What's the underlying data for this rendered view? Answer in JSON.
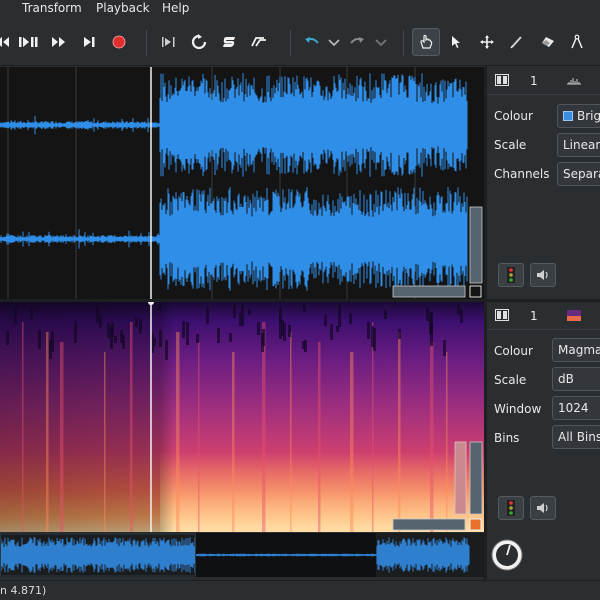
{
  "menu": {
    "transform": "Transform",
    "playback": "Playback",
    "help": "Help"
  },
  "toolbar": {
    "icons": [
      "rewind-icon",
      "play-pause-icon",
      "fast-forward-icon",
      "skip-end-icon",
      "record-icon",
      "play-selection-icon",
      "loop-icon",
      "solo-icon",
      "follow-playback-icon",
      "undo-icon",
      "redo-icon",
      "navigate-icon",
      "select-icon",
      "move-icon",
      "draw-icon",
      "erase-icon",
      "measure-icon"
    ],
    "active_tool": "navigate"
  },
  "waveform_pane": {
    "layer_number": "1",
    "colour_label": "Colour",
    "colour_value": "Brig",
    "colour_swatch": "#3a8de0",
    "scale_label": "Scale",
    "scale_value": "Linear",
    "channels_label": "Channels",
    "channels_value": "Separa",
    "wave_color": "#2f8ee8"
  },
  "spectrogram_pane": {
    "layer_number": "1",
    "colour_label": "Colour",
    "colour_value": "Magma",
    "scale_label": "Scale",
    "scale_value": "dB",
    "window_label": "Window",
    "window_value": "1024",
    "bins_label": "Bins",
    "bins_value": "All Bins"
  },
  "overview": {
    "wave_color": "#2f7fcf"
  },
  "status": {
    "text": "n 4.871)"
  }
}
